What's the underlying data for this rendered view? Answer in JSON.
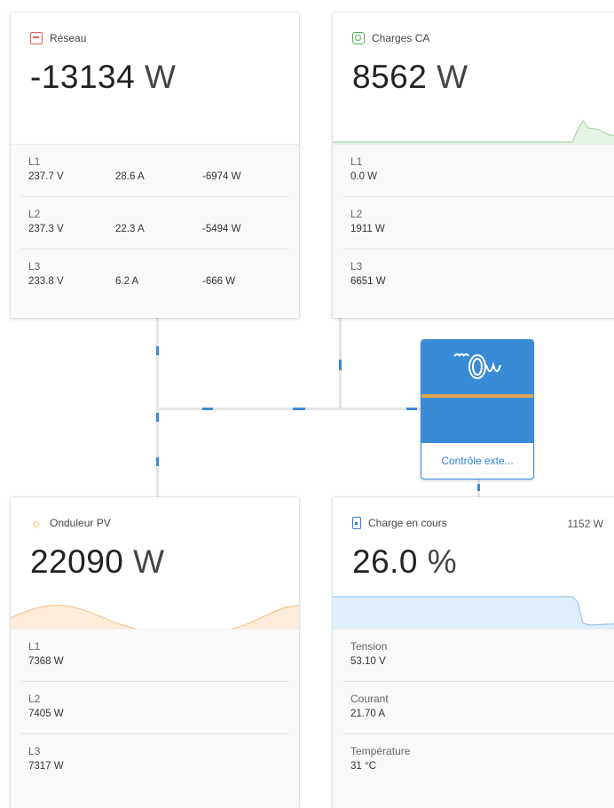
{
  "grid": {
    "title": "Réseau",
    "value": "-13134",
    "unit": "W",
    "phases": [
      {
        "label": "L1",
        "voltage": "237.7 V",
        "current": "28.6 A",
        "power": "-6974 W"
      },
      {
        "label": "L2",
        "voltage": "237.3 V",
        "current": "22.3 A",
        "power": "-5494 W"
      },
      {
        "label": "L3",
        "voltage": "233.8 V",
        "current": "6.2 A",
        "power": "-666 W"
      }
    ]
  },
  "ac_loads": {
    "title": "Charges CA",
    "value": "8562",
    "unit": "W",
    "phases": [
      {
        "label": "L1",
        "power": "0.0 W"
      },
      {
        "label": "L2",
        "power": "1911 W"
      },
      {
        "label": "L3",
        "power": "6651 W"
      }
    ]
  },
  "pv_inverter": {
    "title": "Onduleur PV",
    "value": "22090",
    "unit": "W",
    "phases": [
      {
        "label": "L1",
        "power": "7368 W"
      },
      {
        "label": "L2",
        "power": "7405 W"
      },
      {
        "label": "L3",
        "power": "7317 W"
      }
    ]
  },
  "battery": {
    "title": "Charge en cours",
    "power": "1152 W",
    "value": "26.0",
    "unit": "%",
    "rows": [
      {
        "label": "Tension",
        "value": "53.10 V"
      },
      {
        "label": "Courant",
        "value": "21.70 A"
      },
      {
        "label": "Température",
        "value": "31 °C"
      }
    ]
  },
  "inverter": {
    "label": "Contrôle exte..."
  },
  "colors": {
    "accent": "#3a8bd6",
    "grid": "#e45d5d",
    "ac_loads": "#4caf50",
    "pv": "#f0a030",
    "battery": "#2f7fd4",
    "brand_band": "#e0a64a"
  },
  "icons": {
    "grid": "grid-icon",
    "ac_loads": "ac-loads-icon",
    "pv": "sun-icon",
    "battery": "battery-icon",
    "inverter": "victron-logo-icon"
  }
}
